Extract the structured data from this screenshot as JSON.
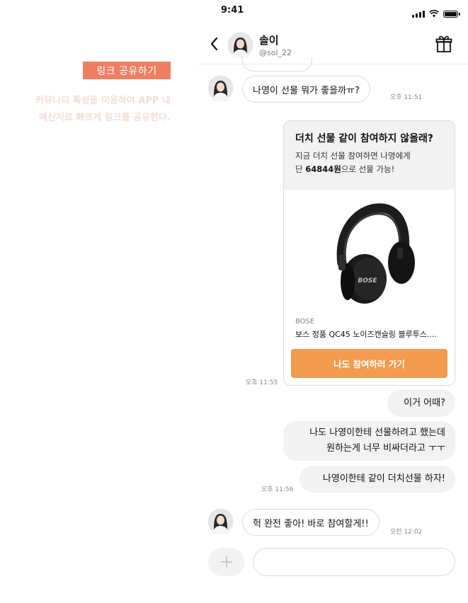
{
  "annotation": {
    "tag": "링크 공유하기",
    "desc_line1": "커뮤니티 특성을 이용하여 APP 내",
    "desc_line2": "메신저로 빠르게 링크를 공유한다."
  },
  "status_bar": {
    "time": "9:41"
  },
  "header": {
    "name": "솔이",
    "handle": "@sol_22"
  },
  "messages": {
    "m1": {
      "text": "나영이 선물 뭐가 좋을까ㅠ?",
      "time": "오후 11:51"
    },
    "card": {
      "title": "더치 선물 같이 참여하지 않을래?",
      "desc_line1": "지금 더치 선물 참여하면 나영에게",
      "desc_prefix": "단 ",
      "price": "64844원",
      "desc_suffix": "으로 선물 가능!",
      "brand": "BOSE",
      "product": "보스 정품 QC45 노이즈캔슬링 블루투스....",
      "button": "나도 참여하러 가기",
      "time": "오후 11:55",
      "product_logo": "BOSE"
    },
    "m2": {
      "text": "이거 어때?"
    },
    "m3": {
      "line1": "나도 나영이한테 선물하려고 했는데",
      "line2": "원하는게 너무 비싸더라고 ㅜㅜ"
    },
    "m4": {
      "text": "나영이한테 같이 더치선물 하자!",
      "time": "오후 11:56"
    },
    "m5": {
      "text": "헉 완전 좋아! 바로 참여할게!!",
      "time": "오전 12:02"
    }
  },
  "input": {
    "placeholder": ""
  },
  "colors": {
    "accent_orange": "#f29a4e",
    "tag_bg": "#ee7f63",
    "bubble_out": "#f2f2f2"
  },
  "icons": [
    "back-arrow-icon",
    "gift-icon",
    "plus-icon",
    "signal-icon",
    "wifi-icon",
    "battery-icon"
  ]
}
